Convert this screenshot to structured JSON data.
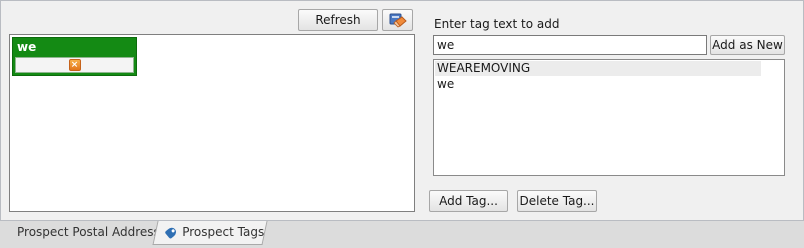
{
  "toolbar": {
    "refresh_label": "Refresh"
  },
  "assigned_tags": [
    {
      "label": "we"
    }
  ],
  "add_tag": {
    "prompt": "Enter tag text to add",
    "input_value": "we",
    "add_new_label": "Add as New"
  },
  "tag_list": {
    "items": [
      "WEAREMOVING",
      "we"
    ],
    "selected": "WEAREMOVING"
  },
  "actions": {
    "add_tag_label": "Add Tag...",
    "delete_tag_label": "Delete Tag..."
  },
  "tabs": [
    {
      "label": "Prospect Postal Address",
      "active": false
    },
    {
      "label": "Prospect Tags",
      "active": true
    }
  ],
  "icons": {
    "erase": "eraser-icon",
    "remove": "remove-tag-icon",
    "tab_tag": "tag-icon"
  },
  "colors": {
    "tag_chip": "#148a14",
    "remove_icon": "#e2761b"
  }
}
